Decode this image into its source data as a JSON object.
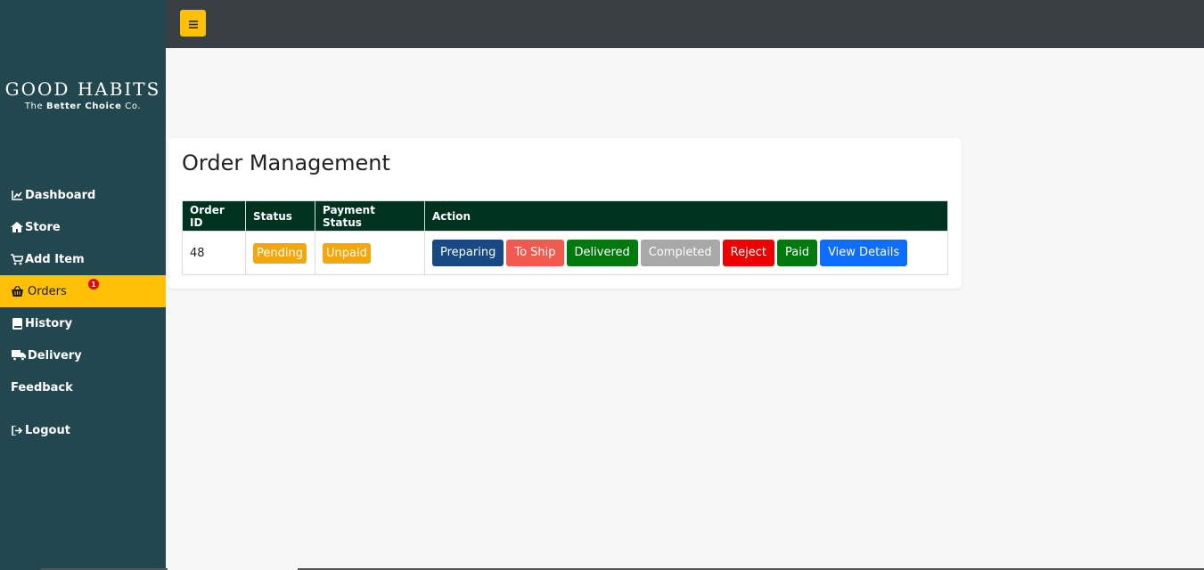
{
  "brand": {
    "name": "GOOD HABITS",
    "tag_prefix": "The",
    "tag_bold": "Better Choice",
    "tag_suffix": "Co."
  },
  "sidebar": {
    "items": [
      {
        "label": "Dashboard",
        "icon": "chart-icon"
      },
      {
        "label": "Store",
        "icon": "home-icon"
      },
      {
        "label": "Add Item",
        "icon": "cart-icon"
      },
      {
        "label": "Orders",
        "icon": "basket-icon",
        "badge": "1",
        "active": true
      },
      {
        "label": "History",
        "icon": "book-icon"
      },
      {
        "label": "Delivery",
        "icon": "truck-icon"
      },
      {
        "label": "Feedback",
        "icon": ""
      },
      {
        "label": "Logout",
        "icon": "logout-icon"
      }
    ]
  },
  "topbar": {
    "menu_icon": "≡"
  },
  "main": {
    "title": "Order Management",
    "table": {
      "headers": [
        "Order ID",
        "Status",
        "Payment Status",
        "Action"
      ],
      "rows": [
        {
          "order_id": "48",
          "status": "Pending",
          "payment_status": "Unpaid",
          "actions": [
            "Preparing",
            "To Ship",
            "Delivered",
            "Completed",
            "Reject",
            "Paid",
            "View Details"
          ]
        }
      ]
    }
  },
  "colors": {
    "sidebar_bg": "#23474f",
    "accent": "#ffc107",
    "table_header": "#003220",
    "pending": "#f4a60d",
    "preparing": "#174a85",
    "to_ship": "#f05a4f",
    "delivered": "#007a0d",
    "completed": "#a8a8a8",
    "reject": "#ee0000",
    "paid": "#007a0d",
    "view_details": "#0d6efd"
  }
}
